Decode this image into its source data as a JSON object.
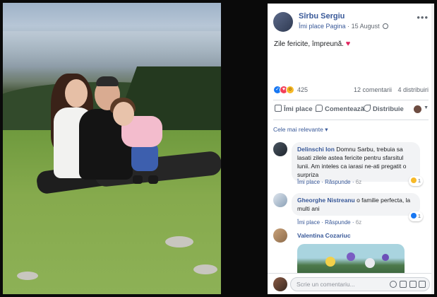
{
  "post": {
    "page_name": "Sîrbu Sergiu",
    "like_page": "Îmi place Pagina",
    "date": "15 August",
    "text": "Zile fericite, împreună.",
    "heart": "♥",
    "more": "•••"
  },
  "reactions": {
    "count": "425",
    "comments": "12 comentarii",
    "shares": "4 distribuiri"
  },
  "actions": {
    "like": "Îmi place",
    "comment": "Comentează",
    "share": "Distribuie",
    "caret": "▼"
  },
  "sort_label": "Cele mai relevante ▾",
  "comments": [
    {
      "author": "Delinschi Ion",
      "text": "Domnu Sarbu, trebuia sa lasati zilele astea fericite pentru sfarsitul lunii. Am inteles ca iarasi ne-ati pregatit o surpriza",
      "like": "Îmi place",
      "reply": "Răspunde",
      "time": "6z",
      "reaction_count": "1"
    },
    {
      "author": "Gheorghe Nistreanu",
      "text": "o familie perfecta, la multi ani",
      "like": "Îmi place",
      "reply": "Răspunde",
      "time": "6z",
      "reaction_count": "1"
    },
    {
      "author": "Valentina Cozariuc"
    }
  ],
  "write_comment": {
    "placeholder": "Scrie un comentariu..."
  },
  "colors": {
    "link": "#385898",
    "like_blue": "#1877f2",
    "love_red": "#f33e58",
    "bubble": "#f2f3f5"
  }
}
